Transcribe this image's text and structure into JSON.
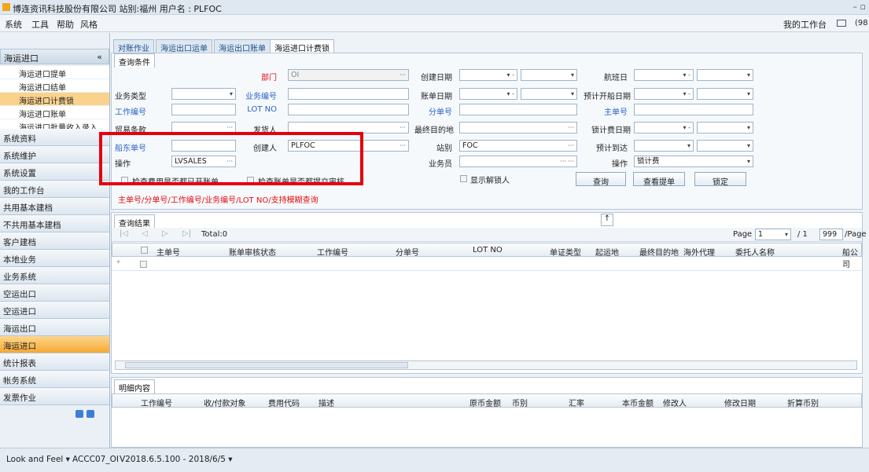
{
  "app": {
    "title": "博连资讯科技股份有限公司 站别:福州    用户名 : PLFOC",
    "window_controls": "– ▫"
  },
  "menu": {
    "items": [
      "系统",
      "工具",
      "帮助",
      "风格"
    ],
    "workbench": "我的工作台",
    "mail_count": "(98"
  },
  "sidebar": {
    "header": "海运进口",
    "collapse": "«",
    "subitems": [
      "海运进口提单",
      "海运进口结单",
      "海运进口计费锁",
      "海运进口账单",
      "海运进口批量收入录入"
    ],
    "categories": [
      "系统资料",
      "系统维护",
      "系统设置",
      "我的工作台",
      "共用基本建档",
      "不共用基本建档",
      "客户建档",
      "本地业务",
      "业务系统",
      "空运出口",
      "空运进口",
      "海运出口",
      "海运进口",
      "统计报表",
      "帐务系统",
      "发票作业"
    ]
  },
  "tabs": [
    "对账作业",
    "海运出口运单",
    "海运出口账单",
    "海运进口计费锁"
  ],
  "query": {
    "title": "查询条件",
    "dept_label": "部门",
    "dept_value": "OI",
    "create_date": "创建日期",
    "bill_date": "账单日期",
    "flight_date": "航班日",
    "biz_type": "业务类型",
    "biz_no": "业务编号",
    "etd": "预计开船日期",
    "job_no": "工作编号",
    "lot_no": "LOT NO",
    "hbl": "分单号",
    "mbl": "主单号",
    "trade": "贸易条款",
    "shipper": "发货人",
    "final_dest": "最终目的地",
    "lock_date": "锁计费日期",
    "vessel_no": "船东单号",
    "creator": "创建人",
    "creator_value": "PLFOC",
    "station": "站别",
    "station_value": "FOC",
    "eta": "预计到达",
    "op_label": "操作",
    "op_value": "LVSALES",
    "sales": "业务员",
    "op2_label": "操作",
    "op2_value": "锁计费",
    "chk1": "检查费用是否都已开账单",
    "chk2": "检查账单是否都提交审核",
    "chk3": "显示解锁人",
    "btn_query": "查询",
    "btn_view": "查看提单",
    "btn_lock": "锁定",
    "hint": "主单号/分单号/工作编号/业务编号/LOT NO/支持模糊查询"
  },
  "results": {
    "title": "查询结果",
    "total": "Total:0",
    "page_label": "Page",
    "page_value": "1",
    "of": "/ 1",
    "page_size": "999",
    "per": "/Page",
    "columns": [
      "主单号",
      "账单审核状态",
      "工作编号",
      "分单号",
      "LOT NO",
      "单证类型",
      "起运地",
      "最终目的地",
      "海外代理",
      "委托人名称",
      "船公司"
    ]
  },
  "detail": {
    "title": "明细内容",
    "columns": [
      "工作编号",
      "收/付款对象",
      "费用代码",
      "描述",
      "原币金额",
      "币别",
      "汇率",
      "本币金额",
      "修改人",
      "修改日期",
      "折算币别"
    ]
  },
  "status": {
    "laf": "Look and Feel ▾",
    "user": "ACCC07_OI",
    "version": "V2018.6.5.100 - 2018/6/5 ▾"
  },
  "colors": {
    "accent": "#fbd28c",
    "highlight": "#e5000e",
    "link": "#2b63c4"
  }
}
